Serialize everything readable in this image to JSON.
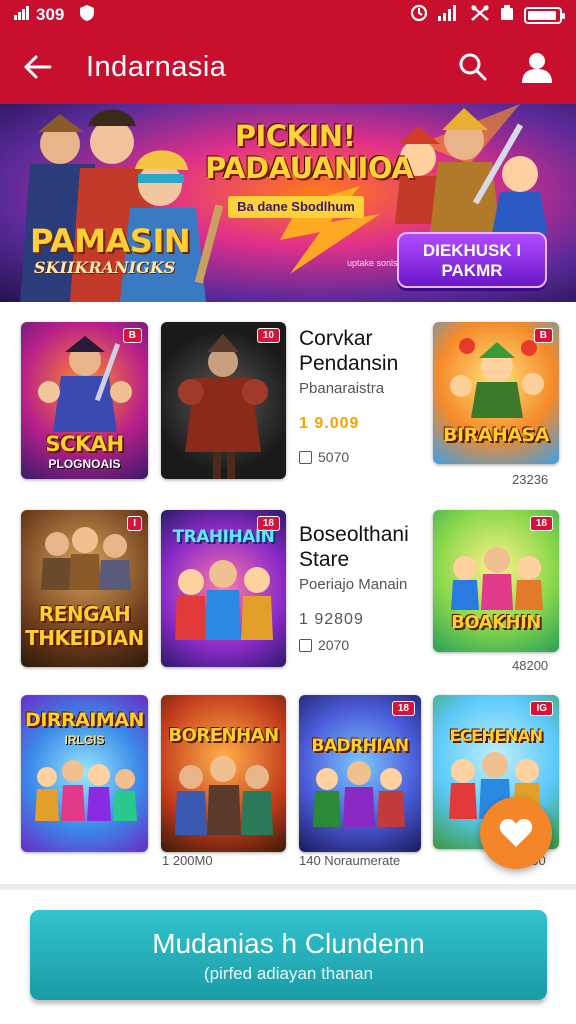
{
  "status_bar": {
    "left_text": "309",
    "signal_left": "signal-icon",
    "colors": {
      "bar": "#c8102e"
    }
  },
  "app_bar": {
    "title": "Indarnasia",
    "back_icon": "arrow-left-icon",
    "search_icon": "search-icon",
    "profile_icon": "user-icon"
  },
  "banner": {
    "headline": "PICKIN! PADAUANIOA",
    "sub": "Ba dane Sbodlhum",
    "left_title": "PAMASIN",
    "left_sub": "SKIIKRANIGKS",
    "cta": "DIEKHUSK I PAKMR",
    "tiny": "uptake sonls"
  },
  "grid": {
    "row1": {
      "card1": {
        "badge": "B",
        "title": "SCKAH",
        "sub": "PLOGNOAIS"
      },
      "card2": {
        "badge": "10"
      },
      "info": {
        "title_line1": "Corvkar",
        "title_line2": "Pendansin",
        "subtitle": "Pbanaraistra",
        "price": "1 9.009",
        "meta": "5070"
      },
      "card4": {
        "badge": "B",
        "title": "BIRAHASA"
      },
      "caption4": "23236"
    },
    "row2": {
      "card1": {
        "badge": "I",
        "title": "RENGAH",
        "title2": "THKEIDIAN"
      },
      "card2": {
        "badge": "18",
        "title": "TRAHIHAIN"
      },
      "info": {
        "title_line1": "Boseolthani",
        "title_line2": "Stare",
        "subtitle": "Poeriajo Manain",
        "price": "1 92809",
        "meta": "2070"
      },
      "card4": {
        "badge": "18",
        "title": "BOAKHIN"
      },
      "caption4": "48200"
    },
    "row3": {
      "card1": {
        "title": "DIRRAIMAN",
        "sub": "IRLGIS"
      },
      "card2": {
        "title": "BORENHAN"
      },
      "card3": {
        "badge": "18",
        "title": "BADRHIAN"
      },
      "card4": {
        "badge": "IG",
        "title": "ECEHENAN"
      },
      "caption2": "1 200M0",
      "caption3": "140 Noraumerate",
      "caption4": "200"
    }
  },
  "fab_icon": "heart-icon",
  "cta": {
    "label": "Mudanias h Clundenn",
    "sub": "(pirfed adiayan thanan"
  }
}
